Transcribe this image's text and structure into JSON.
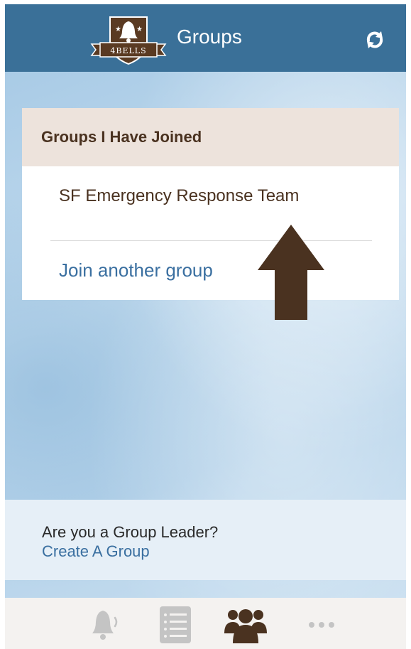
{
  "header": {
    "logo_text": "4BELLS",
    "title": "Groups",
    "refresh_icon": "refresh-icon"
  },
  "joined_card": {
    "title": "Groups I Have Joined",
    "groups": [
      {
        "name": "SF Emergency Response Team"
      }
    ],
    "join_label": "Join another group"
  },
  "leader": {
    "question": "Are you a Group Leader?",
    "create_label": "Create A Group"
  },
  "tabbar": {
    "items": [
      {
        "icon": "bell-icon",
        "active": false
      },
      {
        "icon": "list-icon",
        "active": false
      },
      {
        "icon": "groups-icon",
        "active": true
      },
      {
        "icon": "more-icon",
        "active": false
      }
    ]
  },
  "colors": {
    "header": "#3a7098",
    "brand_brown": "#4a3220",
    "link_blue": "#3a6fa0",
    "card_head": "#ede3dc"
  }
}
